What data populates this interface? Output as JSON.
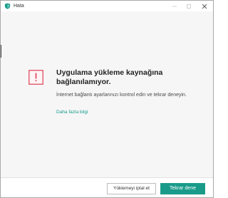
{
  "window": {
    "title": "Hata",
    "app_icon": "kaspersky-shield-icon"
  },
  "error": {
    "icon": "warning-exclamation-icon",
    "heading": "Uygulama yükleme kaynağına bağlanılamıyor.",
    "description": "İnternet bağlantı ayarlarınızı kontrol edin ve tekrar deneyin.",
    "more_link": "Daha fazla bilgi"
  },
  "buttons": {
    "cancel_label": "Yüklemeyi iptal et",
    "retry_label": "Tekrar dene"
  },
  "colors": {
    "accent": "#1a9b8a",
    "warning_border": "#e04f5f",
    "content_bg": "#f6f6f6"
  }
}
